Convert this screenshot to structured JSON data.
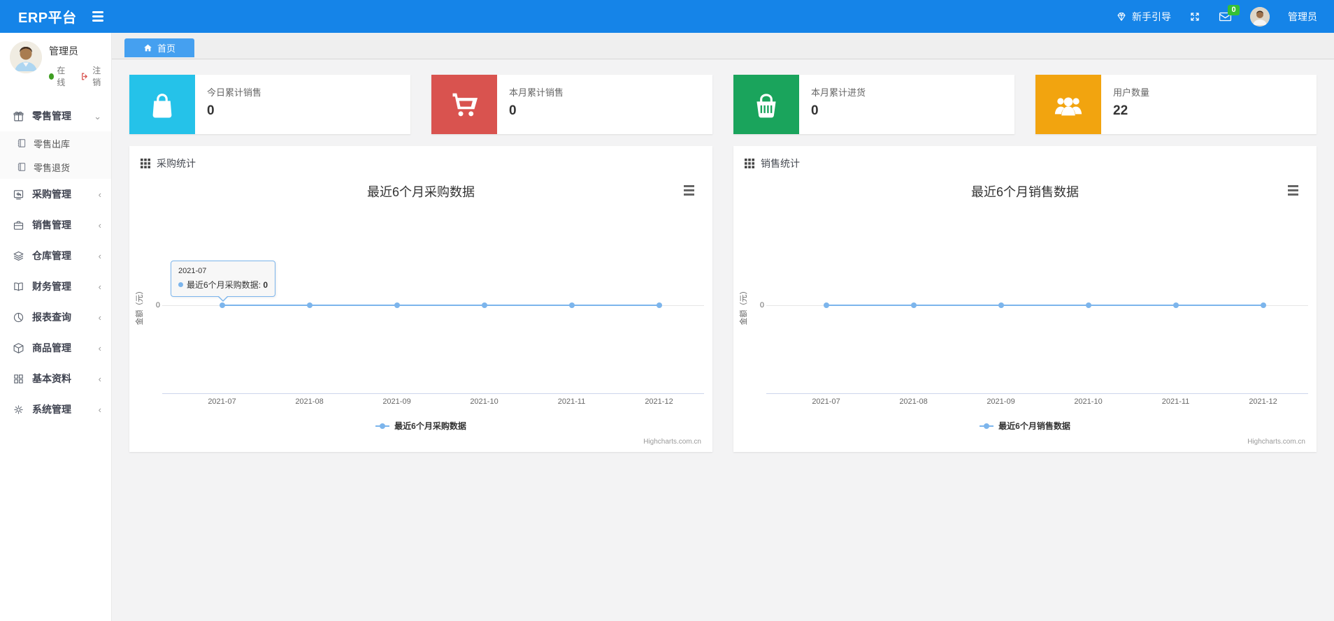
{
  "theme": {
    "navbar_bg": "#1584e8",
    "tab_bg": "#45a0f0",
    "badge_color": "#35c035",
    "online_dot_color": "#3f9e23",
    "logout_icon_color": "#d9534f",
    "series_color": "#7cb5ec"
  },
  "navbar": {
    "brand": "ERP平台",
    "guide_label": "新手引导",
    "badge_count": "0",
    "user_name": "管理员"
  },
  "sidebar": {
    "profile": {
      "name": "管理员",
      "status": "在线",
      "logout": "注销"
    },
    "menu": [
      {
        "label": "零售管理",
        "icon": "gift-icon",
        "expanded": true,
        "children": [
          {
            "label": "零售出库",
            "icon": "journal-icon"
          },
          {
            "label": "零售退货",
            "icon": "journal-icon"
          }
        ]
      },
      {
        "label": "采购管理",
        "icon": "purchase-icon"
      },
      {
        "label": "销售管理",
        "icon": "briefcase-icon"
      },
      {
        "label": "仓库管理",
        "icon": "layers-icon"
      },
      {
        "label": "财务管理",
        "icon": "finance-book-icon"
      },
      {
        "label": "报表查询",
        "icon": "pie-chart-icon"
      },
      {
        "label": "商品管理",
        "icon": "box-icon"
      },
      {
        "label": "基本资料",
        "icon": "grid-2x2-icon"
      },
      {
        "label": "系统管理",
        "icon": "gear-icon"
      }
    ]
  },
  "tabs": {
    "home": "首页"
  },
  "cards": [
    {
      "label": "今日累计销售",
      "value": "0",
      "color": "#25c2e9",
      "icon": "shopping-bag-icon"
    },
    {
      "label": "本月累计销售",
      "value": "0",
      "color": "#d9534f",
      "icon": "shopping-cart-icon"
    },
    {
      "label": "本月累计进货",
      "value": "0",
      "color": "#1aa45c",
      "icon": "shopping-basket-icon"
    },
    {
      "label": "用户数量",
      "value": "22",
      "color": "#f2a40f",
      "icon": "users-icon"
    }
  ],
  "chart_data": [
    {
      "type": "line",
      "panel_title": "采购统计",
      "title": "最近6个月采购数据",
      "x": [
        "2021-07",
        "2021-08",
        "2021-09",
        "2021-10",
        "2021-11",
        "2021-12"
      ],
      "series": [
        {
          "name": "最近6个月采购数据",
          "values": [
            0,
            0,
            0,
            0,
            0,
            0
          ],
          "color": "#7cb5ec"
        }
      ],
      "xlabel": "",
      "ylabel": "金额（元）",
      "yticks": [
        "0"
      ],
      "ylim": [
        -1,
        1
      ],
      "grid": "zero-line only",
      "legend": "最近6个月采购数据",
      "legend_position": "bottom-center",
      "credits": "Highcharts.com.cn",
      "tooltip": {
        "header": "2021-07",
        "series": "最近6个月采购数据",
        "separator": ":",
        "value": "0"
      }
    },
    {
      "type": "line",
      "panel_title": "销售统计",
      "title": "最近6个月销售数据",
      "x": [
        "2021-07",
        "2021-08",
        "2021-09",
        "2021-10",
        "2021-11",
        "2021-12"
      ],
      "series": [
        {
          "name": "最近6个月销售数据",
          "values": [
            0,
            0,
            0,
            0,
            0,
            0
          ],
          "color": "#7cb5ec"
        }
      ],
      "xlabel": "",
      "ylabel": "金额（元）",
      "yticks": [
        "0"
      ],
      "ylim": [
        -1,
        1
      ],
      "grid": "zero-line only",
      "legend": "最近6个月销售数据",
      "legend_position": "bottom-center",
      "credits": "Highcharts.com.cn",
      "tooltip": null
    }
  ]
}
